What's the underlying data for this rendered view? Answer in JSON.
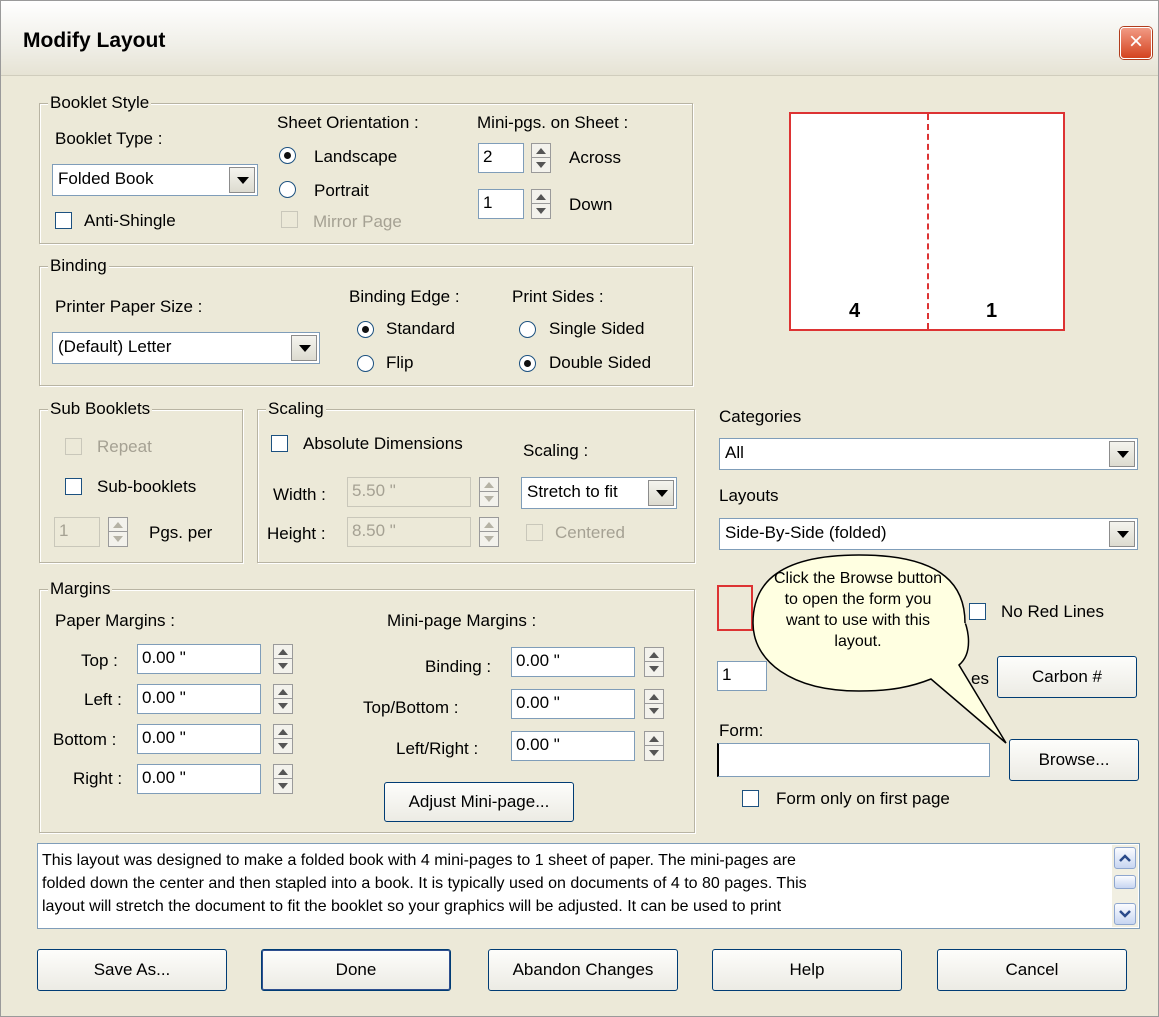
{
  "window": {
    "title": "Modify Layout",
    "close_icon": "×"
  },
  "booklet_style": {
    "legend": "Booklet Style",
    "booklet_type_label": "Booklet Type :",
    "booklet_type_value": "Folded Book",
    "anti_shingle": "Anti-Shingle",
    "sheet_orientation_label": "Sheet Orientation :",
    "landscape": "Landscape",
    "portrait": "Portrait",
    "mirror_page": "Mirror Page",
    "mini_pgs_label": "Mini-pgs. on Sheet :",
    "across_value": "2",
    "across_label": "Across",
    "down_value": "1",
    "down_label": "Down"
  },
  "binding": {
    "legend": "Binding",
    "paper_size_label": "Printer Paper Size :",
    "paper_size_value": "(Default) Letter",
    "edge_label": "Binding Edge :",
    "standard": "Standard",
    "flip": "Flip",
    "print_sides_label": "Print Sides :",
    "single_sided": "Single Sided",
    "double_sided": "Double Sided"
  },
  "sub_booklets": {
    "legend": "Sub Booklets",
    "repeat": "Repeat",
    "sub_booklets": "Sub-booklets",
    "pgs_value": "1",
    "pgs_per": "Pgs. per"
  },
  "scaling": {
    "legend": "Scaling",
    "absolute_dimensions": "Absolute Dimensions",
    "scaling_label": "Scaling :",
    "scaling_value": "Stretch to fit",
    "width_label": "Width :",
    "width_value": "5.50 \"",
    "height_label": "Height :",
    "height_value": "8.50 \"",
    "centered": "Centered"
  },
  "margins": {
    "legend": "Margins",
    "paper_label": "Paper Margins :",
    "top_label": "Top :",
    "top_value": "0.00 \"",
    "left_label": "Left :",
    "left_value": "0.00 \"",
    "bottom_label": "Bottom :",
    "bottom_value": "0.00 \"",
    "right_label": "Right :",
    "right_value": "0.00 \"",
    "mini_label": "Mini-page Margins :",
    "binding_label": "Binding :",
    "binding_value": "0.00 \"",
    "topbottom_label": "Top/Bottom :",
    "topbottom_value": "0.00 \"",
    "leftright_label": "Left/Right :",
    "leftright_value": "0.00 \"",
    "adjust_button": "Adjust Mini-page..."
  },
  "preview": {
    "left_page": "4",
    "right_page": "1"
  },
  "right_panel": {
    "categories_label": "Categories",
    "categories_value": "All",
    "layouts_label": "Layouts",
    "layouts_value": "Side-By-Side (folded)",
    "no_red_lines": "No Red Lines",
    "copies_value": "1",
    "copies_label_tail": "es",
    "carbon_button": "Carbon #",
    "form_label": "Form:",
    "form_value": "",
    "browse_button": "Browse...",
    "form_first_page": "Form only on first page"
  },
  "callout": {
    "text": "Click the Browse button to open the form you want to use with this layout."
  },
  "description": "This layout was designed to make a folded book with 4 mini-pages to 1 sheet of paper. The mini-pages are\nfolded down the center and then stapled into a book.  It is typically used on documents of 4 to 80 pages.  This\nlayout will stretch the document to fit the booklet so your graphics will be adjusted.  It can be used to print",
  "buttons": {
    "save_as": "Save As...",
    "done": "Done",
    "abandon": "Abandon Changes",
    "help": "Help",
    "cancel": "Cancel"
  }
}
